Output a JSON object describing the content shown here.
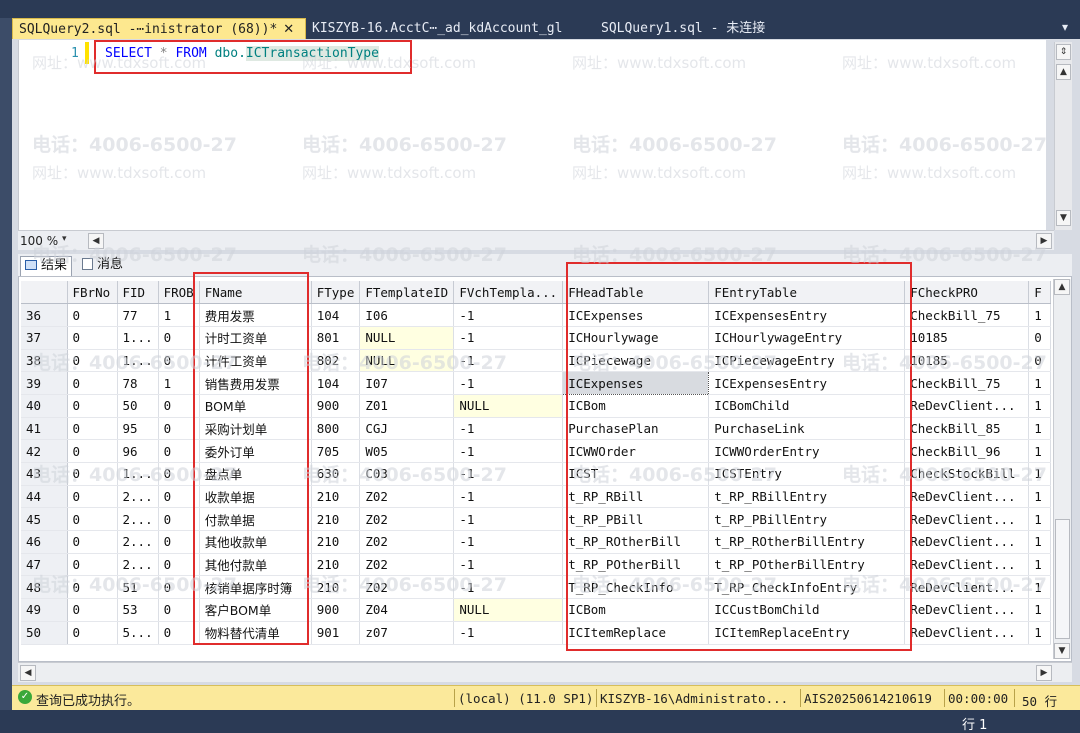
{
  "tabs": [
    {
      "label": "SQLQuery2.sql -⋯inistrator (68))*",
      "close": "✕"
    },
    {
      "label": "KISZYB-16.AcctC⋯_ad_kdAccount_gl"
    },
    {
      "label": "SQLQuery1.sql - 未连接"
    }
  ],
  "tab_dropdown": "▾",
  "editor": {
    "line_number": "1",
    "sql": {
      "select": "SELECT",
      "star": "*",
      "from": "FROM",
      "schema": "dbo.",
      "table": "ICTransactionType"
    }
  },
  "zoom": {
    "value": "100 %",
    "arrow": "▾"
  },
  "result_tabs": [
    {
      "label": "结果"
    },
    {
      "label": "消息"
    }
  ],
  "grid": {
    "columns": [
      "",
      "FBrNo",
      "FID",
      "FROB",
      "FName",
      "FType",
      "FTemplateID",
      "FVchTempla...",
      "FHeadTable",
      "FEntryTable",
      "FCheckPRO",
      "F"
    ],
    "rows": [
      [
        "36",
        "0",
        "77",
        "1",
        "费用发票",
        "104",
        "I06",
        "-1",
        "ICExpenses",
        "ICExpensesEntry",
        "CheckBill_75",
        "1"
      ],
      [
        "37",
        "0",
        "1...",
        "0",
        "计时工资单",
        "801",
        "NULL",
        "-1",
        "ICHourlywage",
        "ICHourlywageEntry",
        "10185",
        "0"
      ],
      [
        "38",
        "0",
        "1...",
        "0",
        "计件工资单",
        "802",
        "NULL",
        "-1",
        "ICPiecewage",
        "ICPiecewageEntry",
        "10185",
        "0"
      ],
      [
        "39",
        "0",
        "78",
        "1",
        "销售费用发票",
        "104",
        "I07",
        "-1",
        "ICExpenses",
        "ICExpensesEntry",
        "CheckBill_75",
        "1"
      ],
      [
        "40",
        "0",
        "50",
        "0",
        "BOM单",
        "900",
        "Z01",
        "NULL",
        "ICBom",
        "ICBomChild",
        "ReDevClient...",
        "1"
      ],
      [
        "41",
        "0",
        "95",
        "0",
        "采购计划单",
        "800",
        "CGJ",
        "-1",
        "PurchasePlan",
        "PurchaseLink",
        "CheckBill_85",
        "1"
      ],
      [
        "42",
        "0",
        "96",
        "0",
        "委外订单",
        "705",
        "W05",
        "-1",
        "ICWWOrder",
        "ICWWOrderEntry",
        "CheckBill_96",
        "1"
      ],
      [
        "43",
        "0",
        "1...",
        "0",
        "盘点单",
        "630",
        "C03",
        "-1",
        "ICST",
        "ICSTEntry",
        "CheckStockBill",
        "1"
      ],
      [
        "44",
        "0",
        "2...",
        "0",
        "收款单据",
        "210",
        "Z02",
        "-1",
        "t_RP_RBill",
        "t_RP_RBillEntry",
        "ReDevClient...",
        "1"
      ],
      [
        "45",
        "0",
        "2...",
        "0",
        "付款单据",
        "210",
        "Z02",
        "-1",
        "t_RP_PBill",
        "t_RP_PBillEntry",
        "ReDevClient...",
        "1"
      ],
      [
        "46",
        "0",
        "2...",
        "0",
        "其他收款单",
        "210",
        "Z02",
        "-1",
        "t_RP_ROtherBill",
        "t_RP_ROtherBillEntry",
        "ReDevClient...",
        "1"
      ],
      [
        "47",
        "0",
        "2...",
        "0",
        "其他付款单",
        "210",
        "Z02",
        "-1",
        "t_RP_POtherBill",
        "t_RP_POtherBillEntry",
        "ReDevClient...",
        "1"
      ],
      [
        "48",
        "0",
        "51",
        "0",
        "核销单据序时簿",
        "210",
        "Z02",
        "-1",
        "T_RP_CheckInfo",
        "T_RP_CheckInfoEntry",
        "ReDevClient...",
        "1"
      ],
      [
        "49",
        "0",
        "53",
        "0",
        "客户BOM单",
        "900",
        "Z04",
        "NULL",
        "ICBom",
        "ICCustBomChild",
        "ReDevClient...",
        "1"
      ],
      [
        "50",
        "0",
        "5...",
        "0",
        "物料替代清单",
        "901",
        "z07",
        "-1",
        "ICItemReplace",
        "ICItemReplaceEntry",
        "ReDevClient...",
        "1"
      ]
    ]
  },
  "status": {
    "message": "查询已成功执行。",
    "server": "(local) (11.0 SP1)",
    "user": "KISZYB-16\\Administrato...",
    "database": "AIS20250614210619",
    "time": "00:00:00",
    "rows": "50 行"
  },
  "row_indicator": "行 1",
  "watermark": {
    "phone": "电话：4006-6500-27",
    "site": "网址：www.tdxsoft.com"
  }
}
